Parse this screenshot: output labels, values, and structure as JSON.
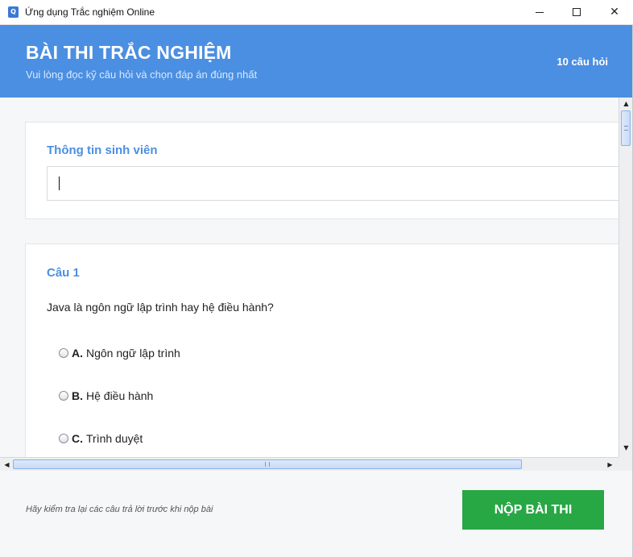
{
  "window": {
    "title": "Ứng dụng Trắc nghiệm Online",
    "icon_letter": "Q",
    "icons": {
      "app": "quiz-app-icon",
      "minimize": "minimize-icon",
      "maximize": "maximize-icon",
      "close": "close-icon"
    },
    "close_glyph": "✕"
  },
  "header": {
    "title": "BÀI THI TRẮC NGHIỆM",
    "subtitle": "Vui lòng đọc kỹ câu hỏi và chọn đáp án đúng nhất",
    "question_count": "10 câu hỏi",
    "background_color": "#4a8fe2"
  },
  "student_info": {
    "heading": "Thông tin sinh viên",
    "input_value": "",
    "accent_color": "#4a8fe2"
  },
  "question": {
    "heading": "Câu 1",
    "text": "Java là ngôn ngữ lập trình hay hệ điều hành?",
    "options": [
      {
        "letter": "A.",
        "label": "Ngôn ngữ lập trình",
        "selected": false
      },
      {
        "letter": "B.",
        "label": "Hệ điều hành",
        "selected": false
      },
      {
        "letter": "C.",
        "label": "Trình duyệt",
        "selected": false
      }
    ]
  },
  "scrollbars": {
    "vertical": {
      "up_glyph": "▲",
      "down_glyph": "▼"
    },
    "horizontal": {
      "left_glyph": "◀",
      "right_glyph": "▶"
    }
  },
  "footer": {
    "hint": "Hãy kiểm tra lại các câu trả lời trước khi nộp bài",
    "submit_label": "NỘP BÀI THI",
    "submit_color": "#28a745"
  }
}
